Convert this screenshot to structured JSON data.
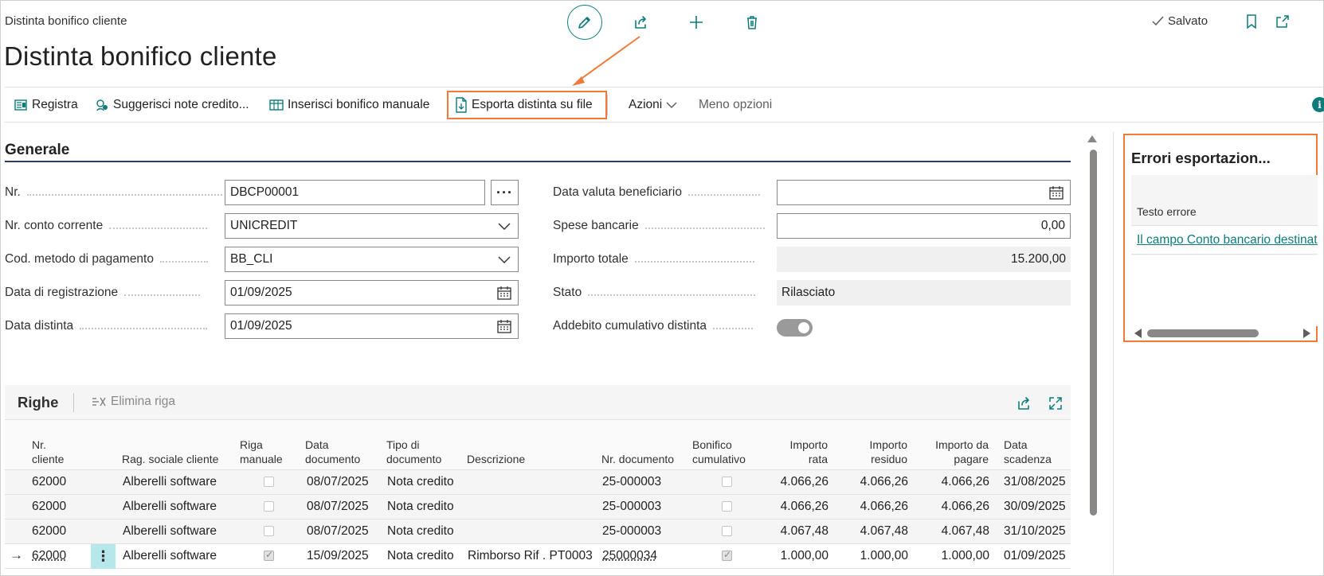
{
  "header": {
    "breadcrumb": "Distinta bonifico cliente",
    "title": "Distinta bonifico cliente",
    "saved_label": "Salvato"
  },
  "actions": {
    "registra": "Registra",
    "suggerisci": "Suggerisci note credito...",
    "inserisci": "Inserisci bonifico manuale",
    "esporta": "Esporta distinta su file",
    "azioni": "Azioni",
    "meno_opzioni": "Meno opzioni"
  },
  "generale": {
    "section_title": "Generale",
    "fields": {
      "nr": {
        "label": "Nr.",
        "value": "DBCP00001"
      },
      "conto": {
        "label": "Nr. conto corrente",
        "value": "UNICREDIT"
      },
      "metodo": {
        "label": "Cod. metodo di pagamento",
        "value": "BB_CLI"
      },
      "data_reg": {
        "label": "Data di registrazione",
        "value": "01/09/2025"
      },
      "data_dist": {
        "label": "Data distinta",
        "value": "01/09/2025"
      },
      "data_valuta": {
        "label": "Data valuta beneficiario",
        "value": ""
      },
      "spese": {
        "label": "Spese bancarie",
        "value": "0,00"
      },
      "importo": {
        "label": "Importo totale",
        "value": "15.200,00"
      },
      "stato": {
        "label": "Stato",
        "value": "Rilasciato"
      },
      "addebito": {
        "label": "Addebito cumulativo distinta",
        "value": true
      }
    }
  },
  "righe": {
    "title": "Righe",
    "elimina_label": "Elimina riga",
    "headers": {
      "nr_cliente": [
        "Nr.",
        "cliente"
      ],
      "rag_sociale": "Rag. sociale cliente",
      "riga_manuale": [
        "Riga",
        "manuale"
      ],
      "data_documento": [
        "Data",
        "documento"
      ],
      "tipo_documento": [
        "Tipo di",
        "documento"
      ],
      "descrizione": "Descrizione",
      "nr_documento": "Nr. documento",
      "bonifico_cumulativo": [
        "Bonifico",
        "cumulativo"
      ],
      "importo_rata": [
        "Importo",
        "rata"
      ],
      "importo_residuo": [
        "Importo",
        "residuo"
      ],
      "importo_da_pagare": [
        "Importo da",
        "pagare"
      ],
      "data_scadenza": [
        "Data",
        "scadenza"
      ]
    },
    "rows": [
      {
        "nr": "62000",
        "rag": "Alberelli software",
        "manuale": false,
        "data": "08/07/2025",
        "tipo": "Nota credito",
        "descr": "",
        "doc": "25-000003",
        "cumulativo": false,
        "rata": "4.066,26",
        "residuo": "4.066,26",
        "pagare": "4.066,26",
        "scadenza": "31/08/2025"
      },
      {
        "nr": "62000",
        "rag": "Alberelli software",
        "manuale": false,
        "data": "08/07/2025",
        "tipo": "Nota credito",
        "descr": "",
        "doc": "25-000003",
        "cumulativo": false,
        "rata": "4.066,26",
        "residuo": "4.066,26",
        "pagare": "4.066,26",
        "scadenza": "30/09/2025"
      },
      {
        "nr": "62000",
        "rag": "Alberelli software",
        "manuale": false,
        "data": "08/07/2025",
        "tipo": "Nota credito",
        "descr": "",
        "doc": "25-000003",
        "cumulativo": false,
        "rata": "4.067,48",
        "residuo": "4.067,48",
        "pagare": "4.067,48",
        "scadenza": "31/10/2025"
      },
      {
        "nr": "62000",
        "rag": "Alberelli software",
        "manuale": true,
        "data": "15/09/2025",
        "tipo": "Nota credito",
        "descr": "Rimborso Rif . PT0003",
        "doc": "25000034",
        "cumulativo": true,
        "rata": "1.000,00",
        "residuo": "1.000,00",
        "pagare": "1.000,00",
        "scadenza": "01/09/2025"
      }
    ]
  },
  "factbox": {
    "title": "Errori esportazion...",
    "column": "Testo errore",
    "error_link": "Il campo Conto bancario destinatario"
  },
  "colors": {
    "accent": "#0e7b7b",
    "highlight": "#f07a3a",
    "section_line": "#2c3a5a"
  }
}
